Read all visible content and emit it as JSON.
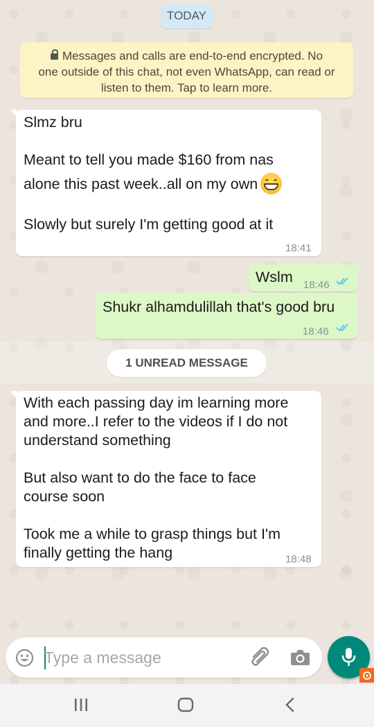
{
  "chat": {
    "date_label": "TODAY",
    "encryption_notice": {
      "icon": "lock-icon",
      "lines": [
        "Messages and calls are end-to-end encrypted. No",
        "one outside of this chat, not even WhatsApp, can read or",
        "listen to them. Tap to learn more."
      ]
    },
    "messages": [
      {
        "direction": "incoming",
        "lines": [
          "Slmz bru",
          "Meant to tell you made $160 from nas",
          "alone this past week..all on my own",
          "Slowly but surely I'm getting good at it"
        ],
        "emoji": "grinning-face-emoji",
        "time": "18:41"
      },
      {
        "direction": "outgoing",
        "lines": [
          "Wslm"
        ],
        "time": "18:46",
        "status": "read"
      },
      {
        "direction": "outgoing",
        "lines": [
          "Shukr alhamdulillah that's good bru"
        ],
        "time": "18:46",
        "status": "read"
      },
      {
        "direction": "incoming",
        "lines": [
          "With each passing day im learning more",
          "and more..I refer to the videos if I do not",
          "understand something",
          "But also want to do the face to face",
          "course soon",
          "Took me a while to grasp things but I'm",
          "finally getting the hang"
        ],
        "time": "18:48"
      }
    ],
    "unread_label": "1 UNREAD MESSAGE"
  },
  "composer": {
    "placeholder": "Type a message",
    "emoji_button_icon": "smiley-icon",
    "attach_icon": "paperclip-icon",
    "camera_icon": "camera-icon",
    "mic_icon": "microphone-icon"
  },
  "navigation": {
    "recents_icon": "recents-icon",
    "home_icon": "home-icon",
    "back_icon": "back-icon"
  },
  "colors": {
    "wallpaper": "#ece5dd",
    "incoming_bubble": "#ffffff",
    "outgoing_bubble": "#dcf8c6",
    "read_ticks": "#4fc3f7",
    "accent": "#00897b"
  }
}
